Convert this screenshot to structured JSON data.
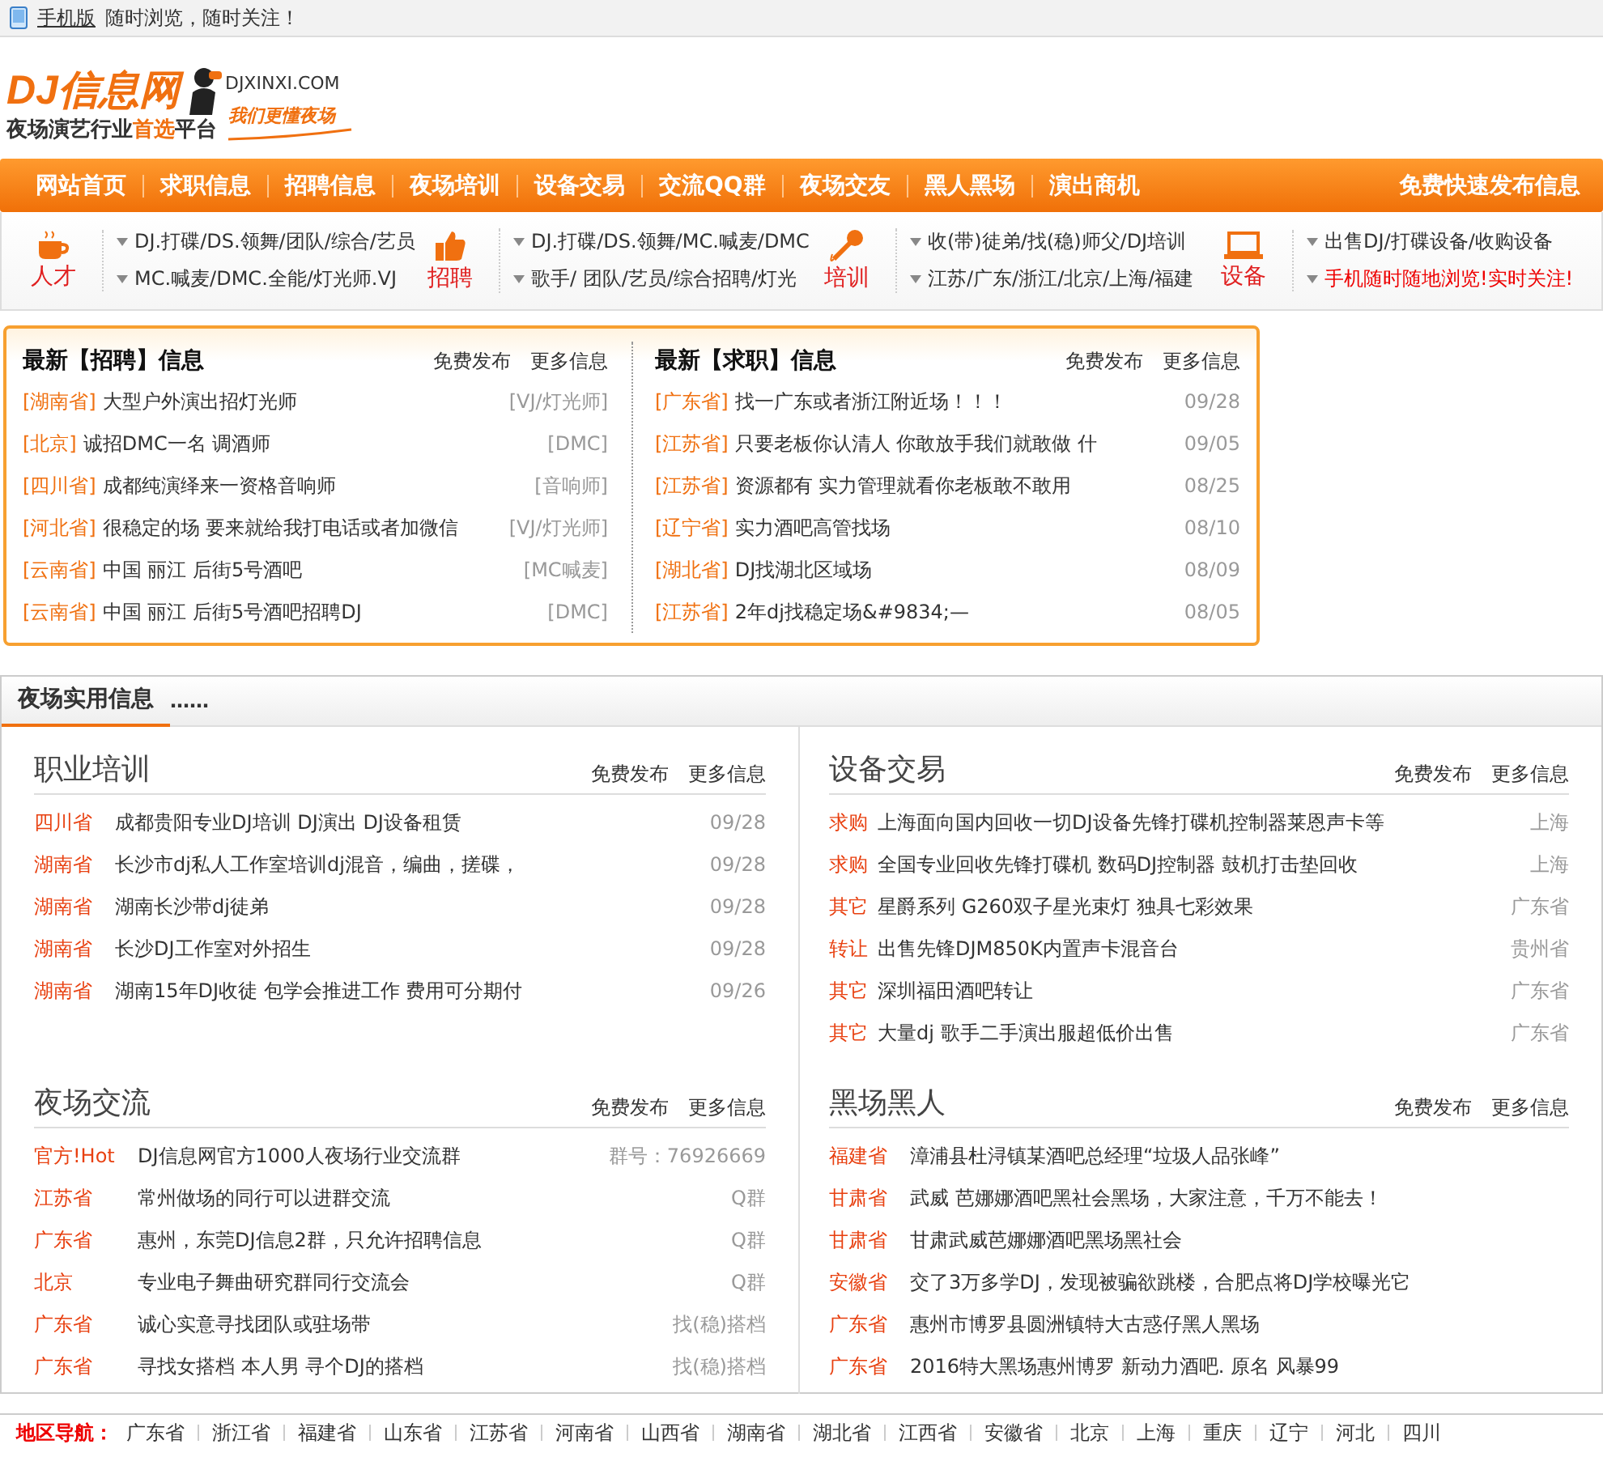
{
  "top_bar": {
    "link": "手机版",
    "text": "随时浏览，随时关注！"
  },
  "logo": {
    "title": "DJ信息网",
    "domain": "DJXINXI.COM",
    "tagline": [
      {
        "text": "夜场演艺行业",
        "highlight": false
      },
      {
        "text": "首选",
        "highlight": true
      },
      {
        "text": "平台",
        "highlight": false
      }
    ],
    "slogan": "我们更懂夜场"
  },
  "nav": {
    "items": [
      "网站首页",
      "求职信息",
      "招聘信息",
      "夜场培训",
      "设备交易",
      "交流QQ群",
      "夜场交友",
      "黑人黑场",
      "演出商机"
    ],
    "publish": "免费快速发布信息"
  },
  "categories": [
    {
      "kind": "cup",
      "label": "人才",
      "links": [
        {
          "text": "DJ.打碟/DS.领舞/团队/综合/艺员",
          "highlight": false
        },
        {
          "text": "MC.喊麦/DMC.全能/灯光师.VJ",
          "highlight": false
        }
      ]
    },
    {
      "kind": "thumb",
      "label": "招聘",
      "links": [
        {
          "text": "DJ.打碟/DS.领舞/MC.喊麦/DMC",
          "highlight": false
        },
        {
          "text": "歌手/ 团队/艺员/综合招聘/灯光",
          "highlight": false
        }
      ]
    },
    {
      "kind": "mic",
      "label": "培训",
      "links": [
        {
          "text": "收(带)徒弟/找(稳)师父/DJ培训",
          "highlight": false
        },
        {
          "text": "江苏/广东/浙江/北京/上海/福建",
          "highlight": false
        }
      ]
    },
    {
      "kind": "laptop",
      "label": "设备",
      "links": [
        {
          "text": "出售DJ/打碟设备/收购设备",
          "highlight": false
        },
        {
          "text": "手机随时随地浏览!实时关注!",
          "highlight": true
        }
      ]
    }
  ],
  "latest": [
    {
      "title": "最新【招聘】信息",
      "actions": [
        "免费发布",
        "更多信息"
      ],
      "rows": [
        {
          "region": "[湖南省]",
          "text": "大型户外演出招灯光师",
          "meta": "[VJ/灯光师]"
        },
        {
          "region": "[北京]",
          "text": "诚招DMC一名 调酒师",
          "meta": "[DMC]"
        },
        {
          "region": "[四川省]",
          "text": "成都纯演绎来一资格音响师",
          "meta": "[音响师]"
        },
        {
          "region": "[河北省]",
          "text": "很稳定的场 要来就给我打电话或者加微信",
          "meta": "[VJ/灯光师]"
        },
        {
          "region": "[云南省]",
          "text": "中国 丽江 后街5号酒吧",
          "meta": "[MC喊麦]"
        },
        {
          "region": "[云南省]",
          "text": "中国 丽江 后街5号酒吧招聘DJ",
          "meta": "[DMC]"
        }
      ]
    },
    {
      "title": "最新【求职】信息",
      "actions": [
        "免费发布",
        "更多信息"
      ],
      "rows": [
        {
          "region": "[广东省]",
          "text": "找一广东或者浙江附近场！！！",
          "meta": "09/28"
        },
        {
          "region": "[江苏省]",
          "text": "只要老板你认清人 你敢放手我们就敢做 什",
          "meta": "09/05"
        },
        {
          "region": "[江苏省]",
          "text": "资源都有 实力管理就看你老板敢不敢用",
          "meta": "08/25"
        },
        {
          "region": "[辽宁省]",
          "text": "实力酒吧高管找场",
          "meta": "08/10"
        },
        {
          "region": "[湖北省]",
          "text": "DJ找湖北区域场",
          "meta": "08/09"
        },
        {
          "region": "[江苏省]",
          "text": "2年dj找稳定场&#9834;—",
          "meta": "08/05"
        }
      ]
    }
  ],
  "practical": {
    "tab": "夜场实用信息",
    "dots": "……",
    "panels": [
      {
        "title": "职业培训",
        "actions": [
          "免费发布",
          "更多信息"
        ],
        "rows": [
          {
            "tag": "四川省",
            "text": "成都贵阳专业DJ培训 DJ演出 DJ设备租赁",
            "meta": "09/28"
          },
          {
            "tag": "湖南省",
            "text": "长沙市dj私人工作室培训dj混音，编曲，搓碟，",
            "meta": "09/28"
          },
          {
            "tag": "湖南省",
            "text": "湖南长沙带dj徒弟",
            "meta": "09/28"
          },
          {
            "tag": "湖南省",
            "text": "长沙DJ工作室对外招生",
            "meta": "09/28"
          },
          {
            "tag": "湖南省",
            "text": "湖南15年DJ收徒 包学会推进工作 费用可分期付",
            "meta": "09/26"
          }
        ]
      },
      {
        "title": "设备交易",
        "actions": [
          "免费发布",
          "更多信息"
        ],
        "rows": [
          {
            "tag": "求购",
            "text": "上海面向国内回收一切DJ设备先锋打碟机控制器莱恩声卡等",
            "meta": "上海"
          },
          {
            "tag": "求购",
            "text": "全国专业回收先锋打碟机 数码DJ控制器 鼓机打击垫回收",
            "meta": "上海"
          },
          {
            "tag": "其它",
            "text": "星爵系列 G260双子星光束灯 独具七彩效果",
            "meta": "广东省"
          },
          {
            "tag": "转让",
            "text": "出售先锋DJM850K内置声卡混音台",
            "meta": "贵州省"
          },
          {
            "tag": "其它",
            "text": "深圳福田酒吧转让",
            "meta": "广东省"
          },
          {
            "tag": "其它",
            "text": "大量dj 歌手二手演出服超低价出售",
            "meta": "广东省"
          }
        ]
      },
      {
        "title": "夜场交流",
        "actions": [
          "免费发布",
          "更多信息"
        ],
        "rows": [
          {
            "tag": "官方!Hot",
            "text": "DJ信息网官方1000人夜场行业交流群",
            "meta": "群号：76926669"
          },
          {
            "tag": "江苏省",
            "text": "常州做场的同行可以进群交流",
            "meta": "Q群"
          },
          {
            "tag": "广东省",
            "text": "惠州，东莞DJ信息2群，只允许招聘信息",
            "meta": "Q群"
          },
          {
            "tag": "北京",
            "text": "专业电子舞曲研究群同行交流会",
            "meta": "Q群"
          },
          {
            "tag": "广东省",
            "text": "诚心实意寻找团队或驻场带",
            "meta": "找(稳)搭档"
          },
          {
            "tag": "广东省",
            "text": "寻找女搭档 本人男 寻个DJ的搭档",
            "meta": "找(稳)搭档"
          }
        ]
      },
      {
        "title": "黑场黑人",
        "actions": [
          "免费发布",
          "更多信息"
        ],
        "rows": [
          {
            "tag": "福建省",
            "text": "漳浦县杜浔镇某酒吧总经理“垃圾人品张峰”"
          },
          {
            "tag": "甘肃省",
            "text": "武威 芭娜娜酒吧黑社会黑场，大家注意，千万不能去！"
          },
          {
            "tag": "甘肃省",
            "text": "甘肃武威芭娜娜酒吧黑场黑社会"
          },
          {
            "tag": "安徽省",
            "text": "交了3万多学DJ，发现被骗欲跳楼，合肥点将DJ学校曝光它"
          },
          {
            "tag": "广东省",
            "text": "惠州市博罗县圆洲镇特大古惑仔黑人黑场"
          },
          {
            "tag": "广东省",
            "text": "2016特大黑场惠州博罗 新动力酒吧. 原名 风暴99"
          }
        ]
      }
    ]
  },
  "region_nav": {
    "label": "地区导航：",
    "items": [
      "广东省",
      "浙江省",
      "福建省",
      "山东省",
      "江苏省",
      "河南省",
      "山西省",
      "湖南省",
      "湖北省",
      "江西省",
      "安徽省",
      "北京",
      "上海",
      "重庆",
      "辽宁",
      "河北",
      "四川"
    ]
  }
}
